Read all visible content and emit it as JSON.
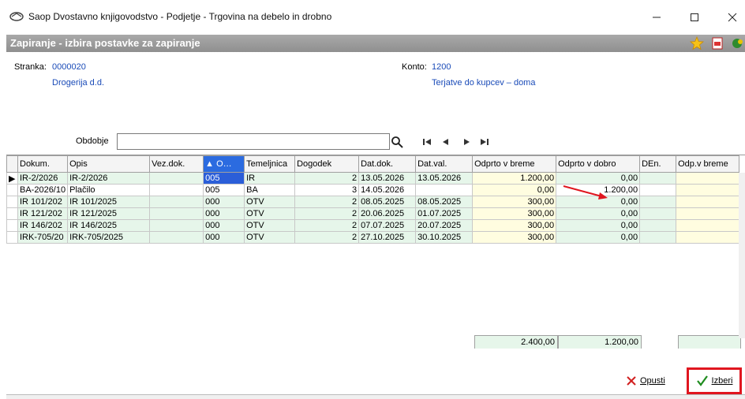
{
  "window": {
    "title": "Saop Dvostavno knjigovodstvo - Podjetje - Trgovina na debelo in drobno"
  },
  "form": {
    "title": "Zapiranje - izbira postavke za zapiranje"
  },
  "info": {
    "stranka_label": "Stranka:",
    "stranka_code": "0000020",
    "stranka_name": "Drogerija d.d.",
    "konto_label": "Konto:",
    "konto_code": "1200",
    "konto_name": "Terjatve do kupcev – doma"
  },
  "toolbar": {
    "obdobje_label": "Obdobje",
    "obdobje_value": ""
  },
  "grid": {
    "columns": [
      "Dokum.",
      "Opis",
      "Vez.dok.",
      "O…",
      "Temeljnica",
      "Dogodek",
      "Dat.dok.",
      "Dat.val.",
      "Odprto v breme",
      "Odprto v dobro",
      "DEn.",
      "Odp.v breme"
    ],
    "sorted_column": "O…",
    "rows": [
      [
        "IR-2/2026",
        "IR-2/2026",
        "",
        "005",
        "IR",
        "2",
        "13.05.2026",
        "13.05.2026",
        "1.200,00",
        "0,00",
        "",
        ""
      ],
      [
        "BA-2026/10",
        "Plačilo",
        "",
        "005",
        "BA",
        "3",
        "14.05.2026",
        "",
        "0,00",
        "1.200,00",
        "",
        ""
      ],
      [
        "IR 101/202",
        "IR 101/2025",
        "",
        "000",
        "OTV",
        "2",
        "08.05.2025",
        "08.05.2025",
        "300,00",
        "0,00",
        "",
        ""
      ],
      [
        "IR 121/202",
        "IR 121/2025",
        "",
        "000",
        "OTV",
        "2",
        "20.06.2025",
        "01.07.2025",
        "300,00",
        "0,00",
        "",
        ""
      ],
      [
        "IR 146/202",
        "IR 146/2025",
        "",
        "000",
        "OTV",
        "2",
        "07.07.2025",
        "20.07.2025",
        "300,00",
        "0,00",
        "",
        ""
      ],
      [
        "IRK-705/20",
        "IRK-705/2025",
        "",
        "000",
        "OTV",
        "2",
        "27.10.2025",
        "30.10.2025",
        "300,00",
        "0,00",
        "",
        ""
      ]
    ],
    "totals": {
      "breme": "2.400,00",
      "dobro": "1.200,00"
    }
  },
  "buttons": {
    "cancel_label": "Opusti",
    "select_label": "Izberi"
  },
  "colors": {
    "accent": "#2b5ed8",
    "highlight_border": "#e0161f",
    "row_green": "#e6f6ea",
    "cell_yellow": "#fffde0",
    "link_blue": "#1a4bb8"
  }
}
